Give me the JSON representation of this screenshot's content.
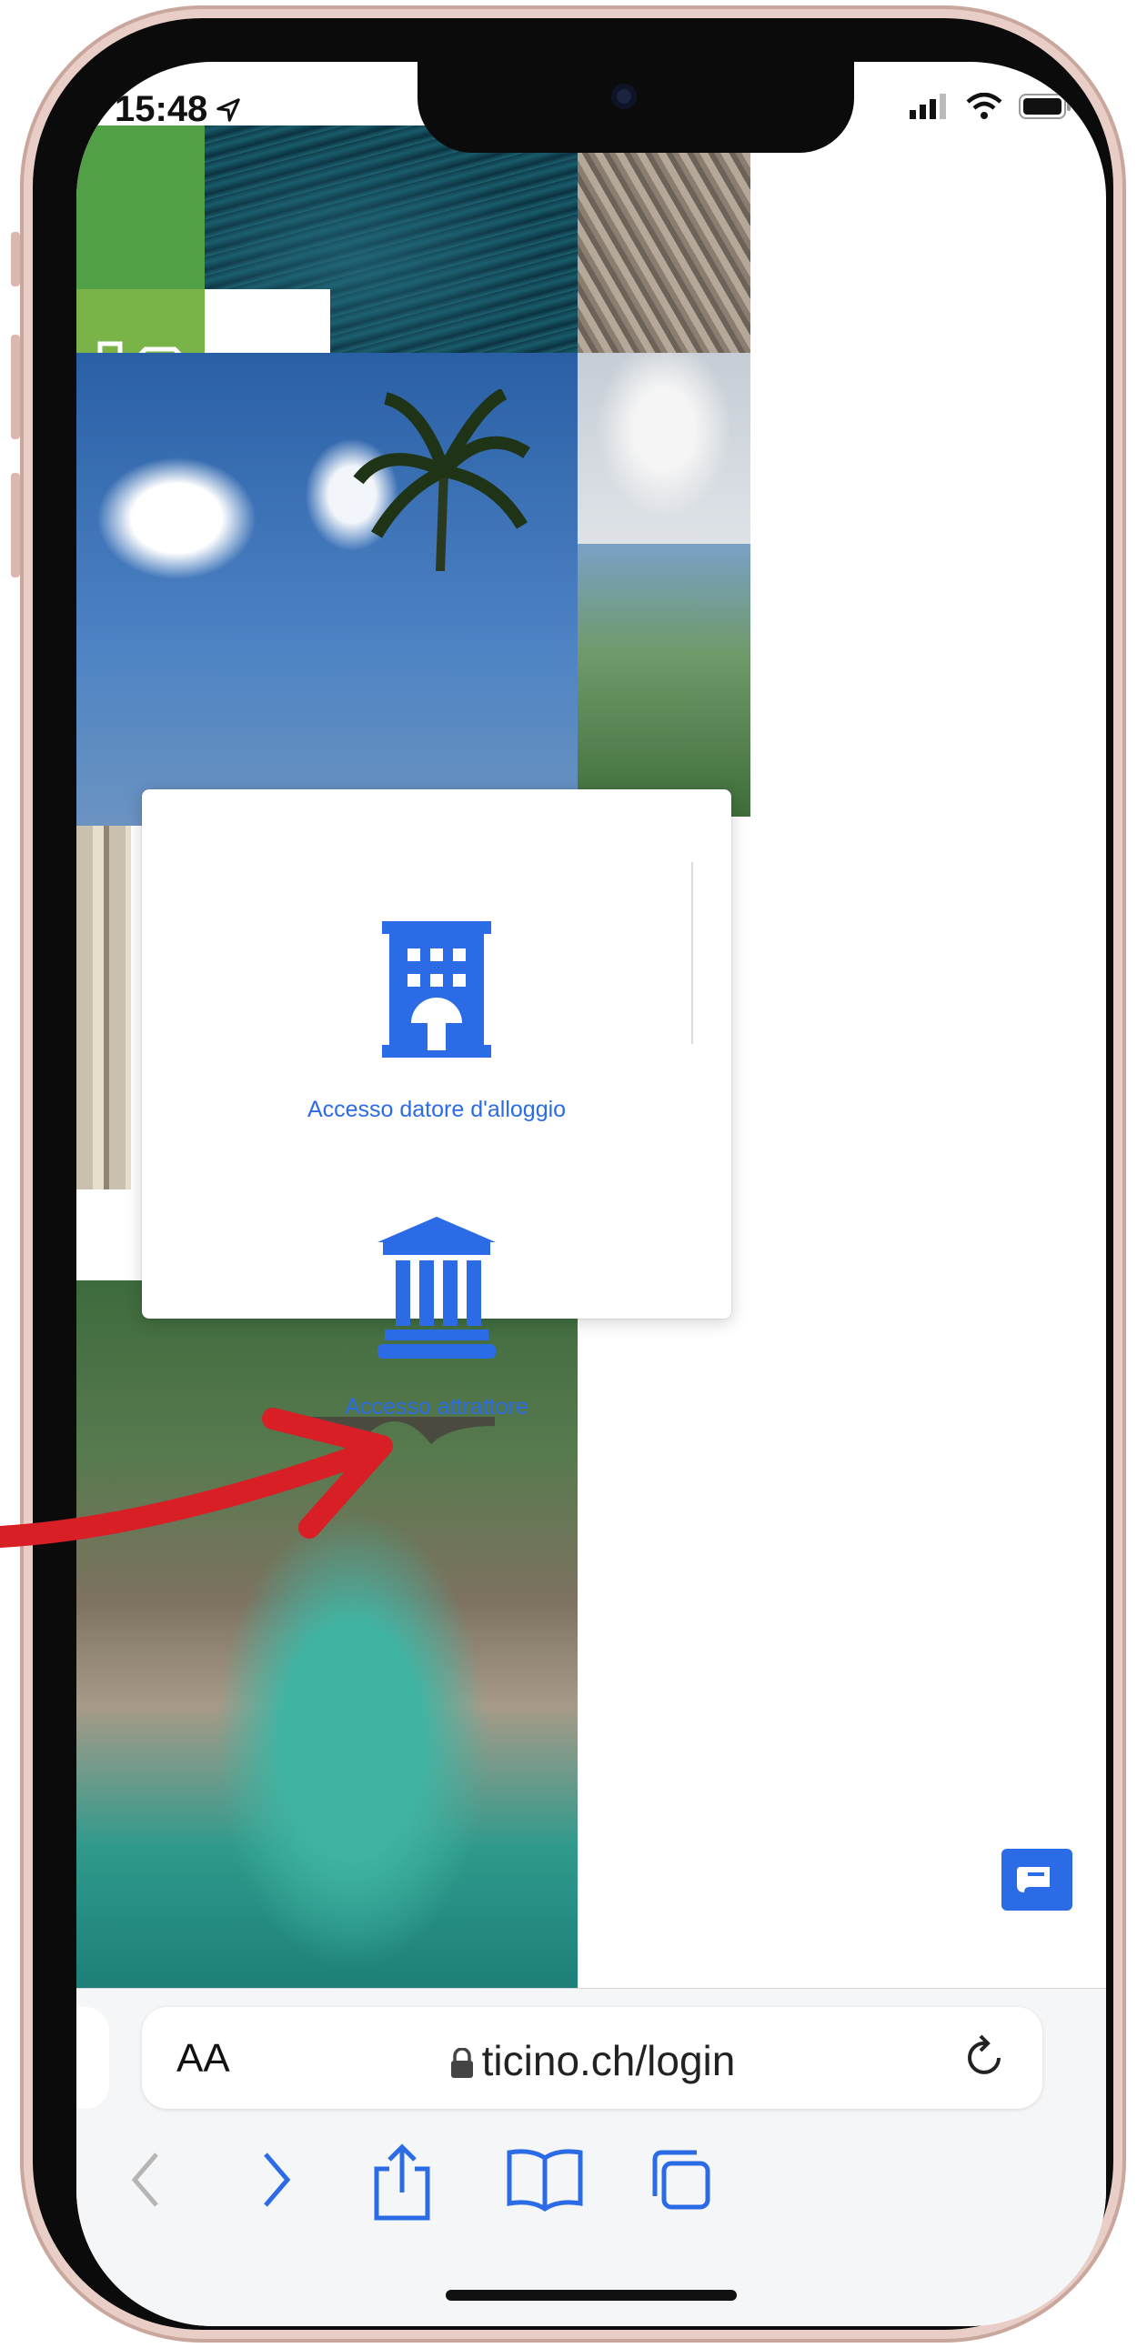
{
  "status_bar": {
    "time": "15:48"
  },
  "card": {
    "option1_label": "Accesso datore d'alloggio",
    "option2_label": "Accesso attrattore"
  },
  "safari": {
    "text_size_label": "AA",
    "url": "ticino.ch/login"
  },
  "icons": [
    "location-arrow-icon",
    "signal-icon",
    "wifi-icon",
    "battery-icon",
    "camera-icon",
    "building-icon",
    "museum-icon",
    "chat-icon",
    "lock-icon",
    "reload-icon",
    "back-icon",
    "forward-icon",
    "share-icon",
    "bookmarks-icon",
    "tabs-icon"
  ],
  "colors": {
    "accent": "#2c6be6",
    "annotation_arrow": "#d81f26",
    "phone_frame": "#e8cec6"
  }
}
